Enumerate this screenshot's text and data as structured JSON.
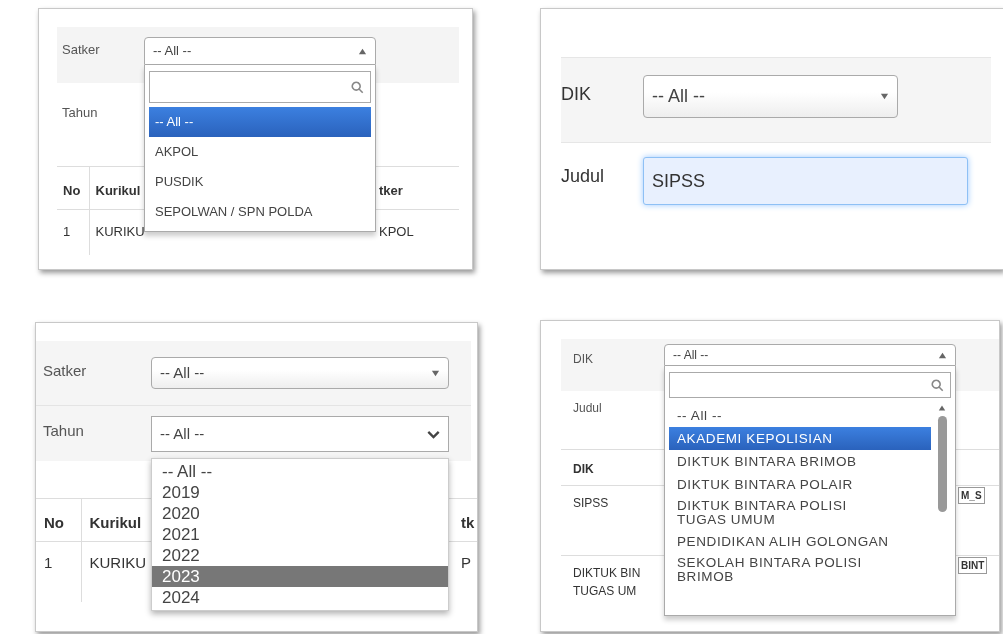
{
  "panels": [
    {
      "filters": [
        {
          "label": "Satker",
          "kind": "select",
          "value": "-- All --",
          "open": true
        },
        {
          "label": "Tahun"
        }
      ],
      "dropdown": {
        "kind": "search",
        "options": [
          {
            "label": "-- All --",
            "selected": true
          },
          {
            "label": "AKPOL",
            "selected": false
          },
          {
            "label": "PUSDIK",
            "selected": false
          },
          {
            "label": "SEPOLWAN / SPN POLDA",
            "selected": false
          }
        ]
      },
      "table": {
        "columns": [
          "No",
          "Kurikul",
          "tker"
        ],
        "rows": [
          {
            "cells": [
              "1",
              "KURIKU",
              "KPOL"
            ]
          }
        ]
      }
    },
    {
      "filters": [
        {
          "label": "DIK",
          "kind": "select",
          "value": "-- All --",
          "open": false
        },
        {
          "label": "Judul",
          "kind": "text",
          "value": "SIPSS"
        }
      ]
    },
    {
      "filters": [
        {
          "label": "Satker",
          "kind": "select",
          "value": "-- All --",
          "open": false
        },
        {
          "label": "Tahun",
          "kind": "native",
          "value": "-- All --",
          "open": true
        }
      ],
      "dropdown": {
        "kind": "native",
        "options": [
          {
            "label": "-- All --",
            "selected": false
          },
          {
            "label": "2019",
            "selected": false
          },
          {
            "label": "2020",
            "selected": false
          },
          {
            "label": "2021",
            "selected": false
          },
          {
            "label": "2022",
            "selected": false
          },
          {
            "label": "2023",
            "selected": true
          },
          {
            "label": "2024",
            "selected": false
          }
        ]
      },
      "table": {
        "columns": [
          "No",
          "Kurikul",
          "tk"
        ],
        "rows": [
          {
            "cells": [
              "1",
              "KURIKU",
              "P"
            ]
          }
        ]
      }
    },
    {
      "filters": [
        {
          "label": "DIK",
          "kind": "select",
          "value": "-- All --",
          "open": true
        },
        {
          "label": "Judul"
        }
      ],
      "dropdown": {
        "kind": "search",
        "scrollbar": true,
        "options": [
          {
            "label": "-- All --",
            "selected": false
          },
          {
            "label": "AKADEMI KEPOLISIAN",
            "selected": true
          },
          {
            "label": "DIKTUK BINTARA BRIMOB",
            "selected": false
          },
          {
            "label": "DIKTUK BINTARA POLAIR",
            "selected": false
          },
          {
            "label": "DIKTUK BINTARA POLISI TUGAS UMUM",
            "selected": false
          },
          {
            "label": "PENDIDIKAN ALIH GOLONGAN",
            "selected": false
          },
          {
            "label": "SEKOLAH BINTARA POLISI BRIMOB",
            "selected": false
          }
        ]
      },
      "table": {
        "columns": [
          "DIK"
        ],
        "rows": [
          {
            "cells": [
              "SIPSS"
            ],
            "tag": "M_S"
          },
          {
            "cells": [
              "DIKTUK BIN\nTUGAS UM"
            ],
            "tag": "BINT"
          }
        ]
      }
    }
  ]
}
